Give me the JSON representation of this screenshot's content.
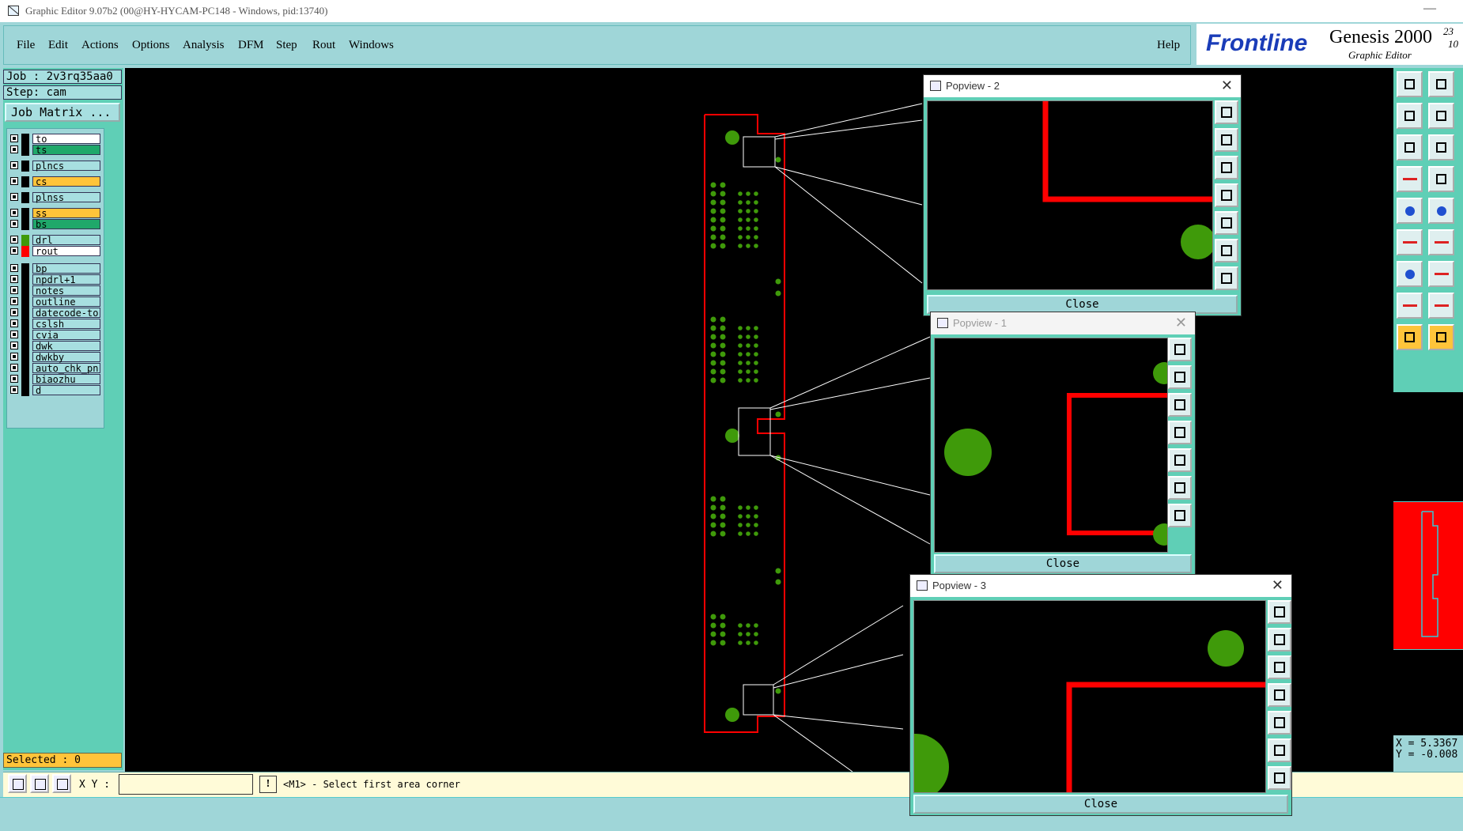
{
  "window": {
    "title": "Graphic Editor 9.07b2 (00@HY-HYCAM-PC148 - Windows, pid:13740)",
    "minimize": "—"
  },
  "menu": {
    "items": [
      "File",
      "Edit",
      "Actions",
      "Options",
      "Analysis",
      "DFM",
      "Step",
      "Rout",
      "Windows"
    ],
    "help": "Help"
  },
  "brand": {
    "logo": "Frontline",
    "product": "Genesis 2000",
    "subtitle": "Graphic Editor",
    "num1": "23",
    "num2": "10"
  },
  "job": {
    "job_label": "Job : 2v3rq35aa0",
    "step_label": "Step: cam",
    "matrix_button": "Job Matrix ..."
  },
  "layers": [
    {
      "name": "to",
      "color": "#ffffff"
    },
    {
      "name": "ts",
      "color": "#1fa86a"
    },
    {
      "name": "plncs",
      "color": "#a7dfe0"
    },
    {
      "name": "cs",
      "color": "#ffc43a"
    },
    {
      "name": "plnss",
      "color": "#a7dfe0"
    },
    {
      "name": "ss",
      "color": "#ffc43a"
    },
    {
      "name": "bs",
      "color": "#1fa86a"
    },
    {
      "name": "drl",
      "color": "#a7dfe0"
    },
    {
      "name": "rout",
      "color": "#ffffff"
    },
    {
      "name": "bp",
      "color": "#a7dfe0"
    },
    {
      "name": "npdrl+1",
      "color": "#a7dfe0"
    },
    {
      "name": "notes",
      "color": "#a7dfe0"
    },
    {
      "name": "outline",
      "color": "#a7dfe0"
    },
    {
      "name": "datecode-to",
      "color": "#a7dfe0"
    },
    {
      "name": "cslsh",
      "color": "#a7dfe0"
    },
    {
      "name": "cvia",
      "color": "#a7dfe0"
    },
    {
      "name": "dwk",
      "color": "#a7dfe0"
    },
    {
      "name": "dwkby",
      "color": "#a7dfe0"
    },
    {
      "name": "auto_chk_pn",
      "color": "#a7dfe0"
    },
    {
      "name": "biaozhu",
      "color": "#a7dfe0"
    },
    {
      "name": "d",
      "color": "#a7dfe0"
    }
  ],
  "selected": "Selected : 0",
  "status": {
    "xy_label": "X Y :",
    "xy_value": "",
    "warn": "!",
    "prompt": "<M1> - Select first area corner"
  },
  "readout": {
    "x": "X = 5.3367",
    "y": "Y = -0.008"
  },
  "popviews": [
    {
      "title": "Popview - 2",
      "close": "Close"
    },
    {
      "title": "Popview - 1",
      "close": "Close"
    },
    {
      "title": "Popview - 3",
      "close": "Close"
    }
  ],
  "colors": {
    "board_outline": "#ff0000",
    "pads": "#3f9a0a",
    "canvas": "#000000",
    "accent": "#5fcfb6"
  }
}
